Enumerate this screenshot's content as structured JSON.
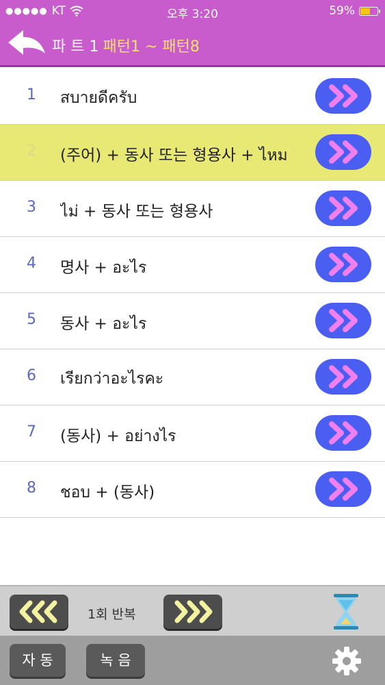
{
  "status_bar": {
    "carrier": "KT",
    "time": "오후 3:20",
    "battery_percent": "59%",
    "battery_level": 0.59,
    "signal_icon": "signal-dots-icon",
    "wifi_icon": "wifi-icon"
  },
  "header": {
    "part_label": "파 트 1",
    "range_label": "패턴1 ~ 패턴8",
    "back_icon": "back-arrow-icon"
  },
  "patterns": [
    {
      "num": "1",
      "text": "สบายดีครับ"
    },
    {
      "num": "2",
      "text": "(주어) + 동사 또는 형용사 + ไหม"
    },
    {
      "num": "3",
      "text": "ไม่ + 동사 또는 형용사"
    },
    {
      "num": "4",
      "text": "명사 + อะไร"
    },
    {
      "num": "5",
      "text": "동사 + อะไร"
    },
    {
      "num": "6",
      "text": "เรียกว่าอะไรคะ"
    },
    {
      "num": "7",
      "text": "(동사) + อย่างไร"
    },
    {
      "num": "8",
      "text": "ชอบ + (동사)"
    }
  ],
  "selected_index": 1,
  "toolbar": {
    "repeat_label": "1회 반복",
    "prev_icon": "triple-chevron-left-icon",
    "next_icon": "triple-chevron-right-icon",
    "timer_icon": "hourglass-icon"
  },
  "bottom_bar": {
    "auto_label": "자 동",
    "record_label": "녹 음",
    "settings_icon": "gear-icon"
  },
  "colors": {
    "header_bg": "#c95ccd",
    "range_text": "#ffe36a",
    "selected_row": "#e8e874",
    "play_button": "#4b5ef2",
    "play_chevron": "#f07ff0"
  }
}
